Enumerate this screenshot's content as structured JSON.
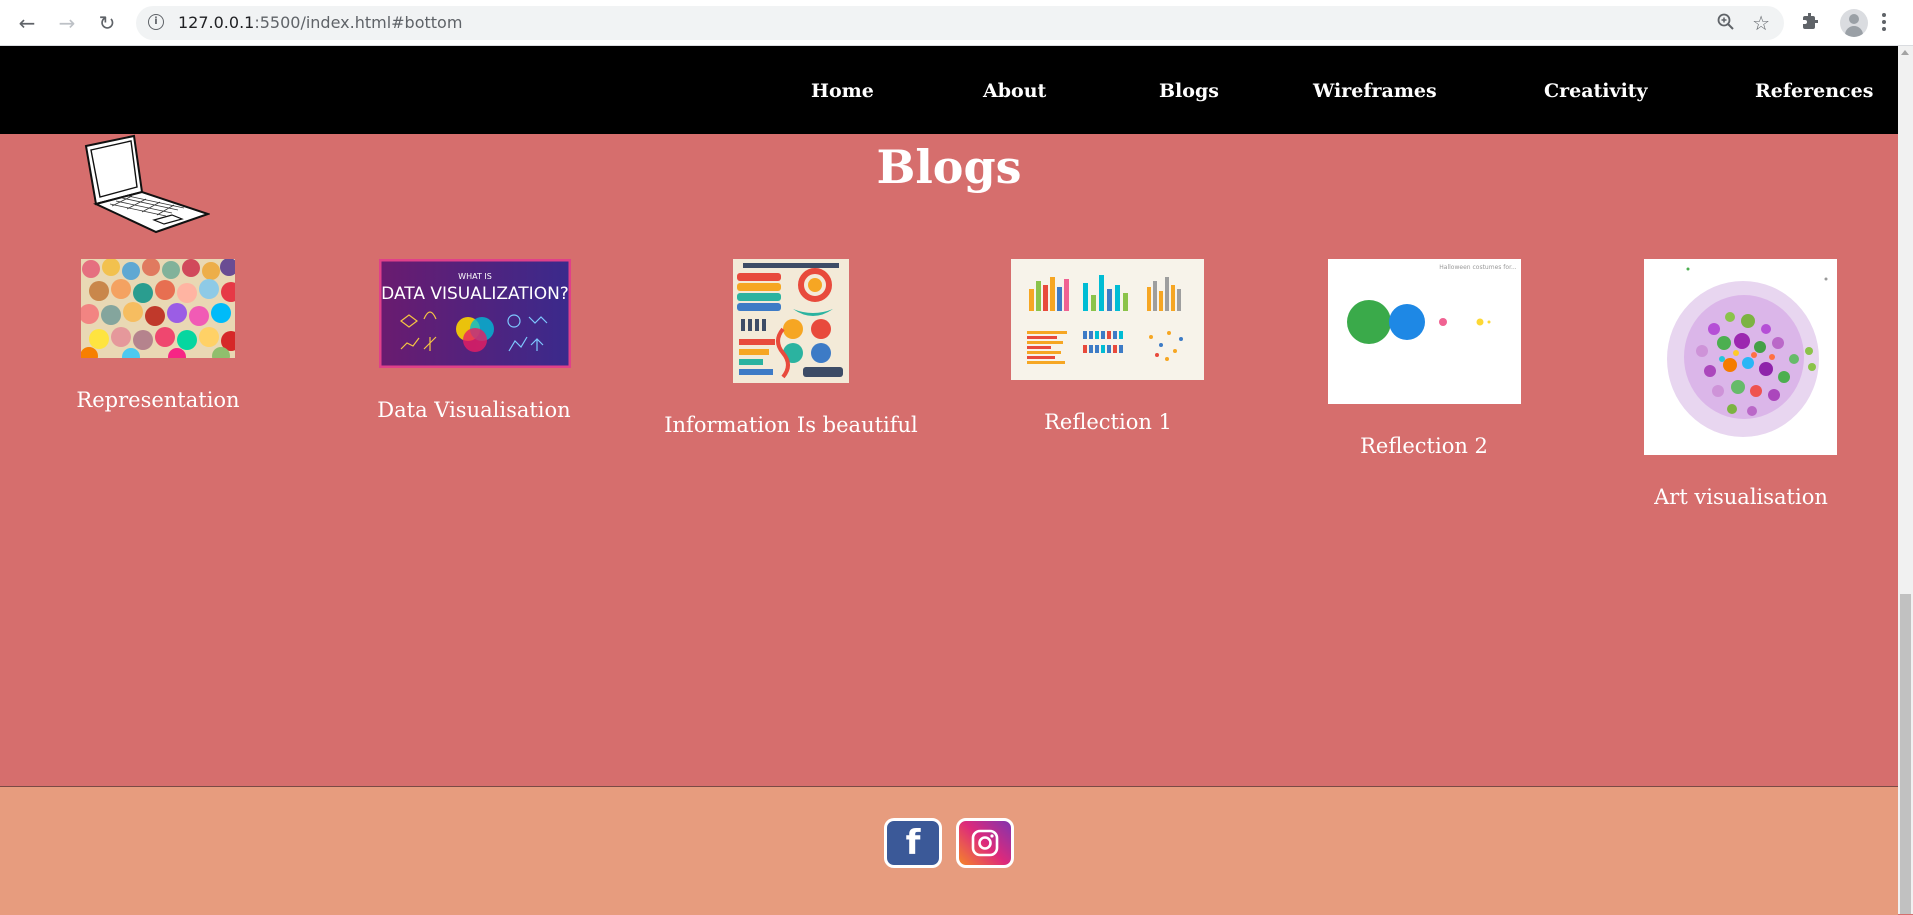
{
  "browser": {
    "url_host": "127.0.0.1",
    "url_rest": ":5500/index.html#bottom"
  },
  "nav": {
    "items": [
      "Home",
      "About",
      "Blogs",
      "Wireframes",
      "Creativity",
      "References"
    ]
  },
  "main": {
    "title": "Blogs",
    "cards": [
      {
        "caption": "Representation",
        "image": "crowd-of-faces-illustration"
      },
      {
        "caption": "Data Visualisation",
        "image": "what-is-data-visualization-banner",
        "image_text_small": "WHAT IS",
        "image_text_large": "DATA VISUALIZATION?"
      },
      {
        "caption": "Information Is beautiful",
        "image": "infographic-poster"
      },
      {
        "caption": "Reflection 1",
        "image": "bar-chart-samples"
      },
      {
        "caption": "Reflection 2",
        "image": "bubble-chart",
        "image_text": "Halloween costumes for..."
      },
      {
        "caption": "Art visualisation",
        "image": "network-graph"
      }
    ]
  },
  "footer": {
    "social": [
      "facebook-icon",
      "instagram-icon"
    ],
    "facebook_glyph": "f"
  },
  "colors": {
    "page_bg": "#d66e6d",
    "nav_bg": "#000000",
    "footer_bg": "#e79c7e",
    "facebook": "#3b5998"
  }
}
